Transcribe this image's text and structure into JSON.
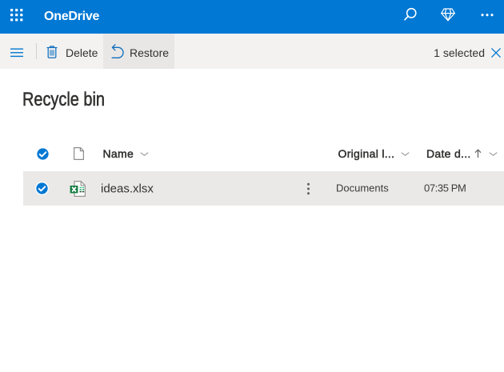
{
  "suite_bar": {
    "app_name": "OneDrive",
    "icons": [
      "app-launcher",
      "search",
      "premium-diamond",
      "more-options"
    ]
  },
  "command_bar": {
    "delete_label": "Delete",
    "restore_label": "Restore",
    "selection_status": "1 selected"
  },
  "page": {
    "title": "Recycle bin"
  },
  "table": {
    "columns": {
      "name": "Name",
      "original_location": "Original l...",
      "date_deleted": "Date d..."
    },
    "sort": {
      "column": "date_deleted",
      "direction": "ascending"
    },
    "rows": [
      {
        "name": "ideas.xlsx",
        "file_type": "xlsx",
        "original_location": "Documents",
        "date_deleted": "07:35 PM",
        "selected": true
      }
    ]
  },
  "colors": {
    "brand_blue": "#0078d4",
    "toolbar_bg": "#f3f2f1",
    "toolbar_hover_bg": "#e9e7e5",
    "row_selected_bg": "#ebe9e7",
    "icon_blue": "#106ebe",
    "text_primary": "#323130",
    "text_secondary": "#484644"
  }
}
